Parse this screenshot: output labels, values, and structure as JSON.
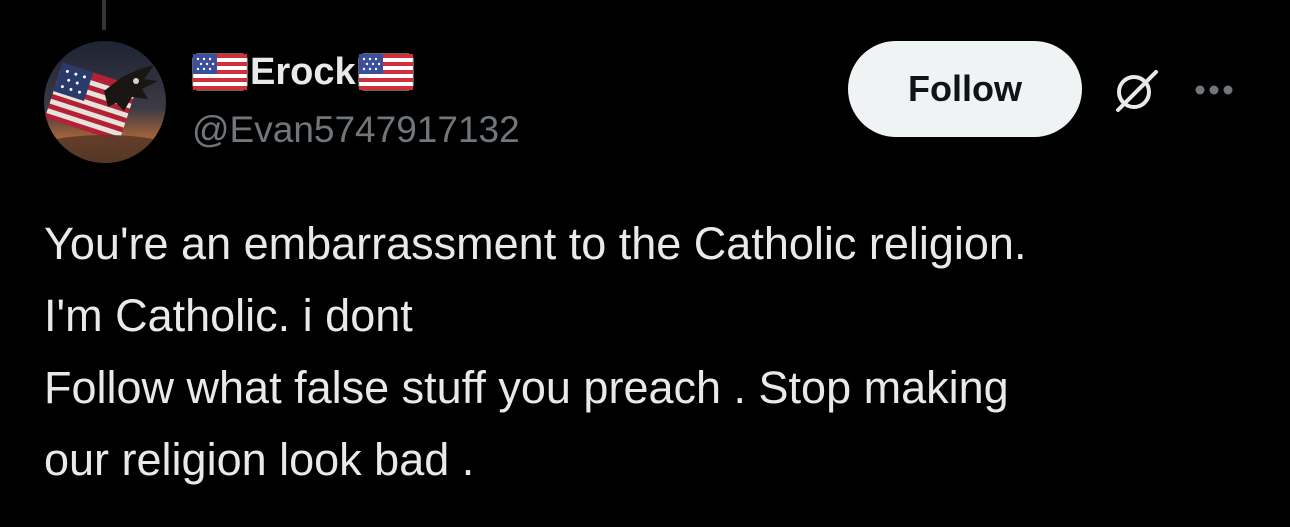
{
  "author": {
    "display_name": "Erock",
    "name_prefix_emoji": "us-flag-emoji",
    "name_suffix_emoji": "us-flag-emoji",
    "handle": "@Evan5747917132",
    "avatar": "american-flag-eagle-avatar"
  },
  "actions": {
    "follow_label": "Follow",
    "grok_icon": "grok-icon",
    "more_icon": "more-options-icon"
  },
  "tweet": {
    "lines": [
      "You're an embarrassment to the Catholic religion.",
      "I'm Catholic. i dont",
      "Follow what false stuff you preach . Stop making",
      "our religion look bad ."
    ]
  },
  "colors": {
    "background": "#000000",
    "text_primary": "#e7e9ea",
    "text_secondary": "#71767b",
    "button_bg": "#eff3f4",
    "button_text": "#0f1419"
  }
}
